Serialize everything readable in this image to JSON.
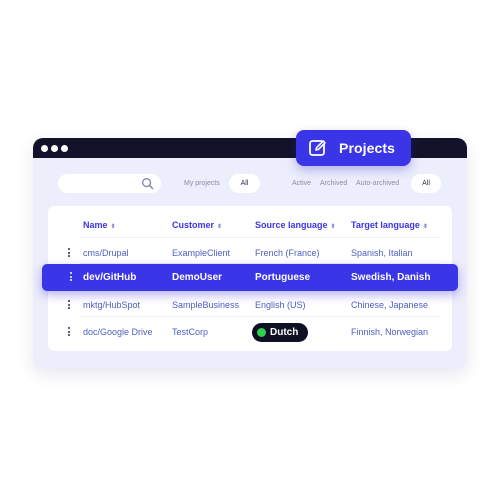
{
  "badge": {
    "label": "Projects",
    "icon": "edit-icon"
  },
  "filters": {
    "search_placeholder": "",
    "my_projects": "My projects",
    "all_left": "All",
    "active": "Active",
    "archived": "Archived",
    "auto_archived": "Auto-archived",
    "all_right": "All"
  },
  "table": {
    "headers": [
      "Name",
      "Customer",
      "Source language",
      "Target language"
    ],
    "sort_glyph": "⬍",
    "rows": [
      {
        "name": "cms/Drupal",
        "customer": "ExampleClient",
        "source": "French (France)",
        "target": "Spanish, Italian"
      },
      {
        "name": "dev/GitHub",
        "customer": "DemoUser",
        "source": "Portuguese",
        "target": "Swedish, Danish",
        "highlighted": true
      },
      {
        "name": "mktg/HubSpot",
        "customer": "SampleBusiness",
        "source": "English (US)",
        "target": "Chinese, Japanese"
      },
      {
        "name": "doc/Google Drive",
        "customer": "TestCorp",
        "source": "Dutch",
        "target": "Finnish, Norwegian",
        "source_badge": true
      }
    ]
  },
  "colors": {
    "accent": "#3b35e8",
    "dark": "#12132a",
    "status_green": "#2ed14f",
    "bg": "#eceefb"
  }
}
